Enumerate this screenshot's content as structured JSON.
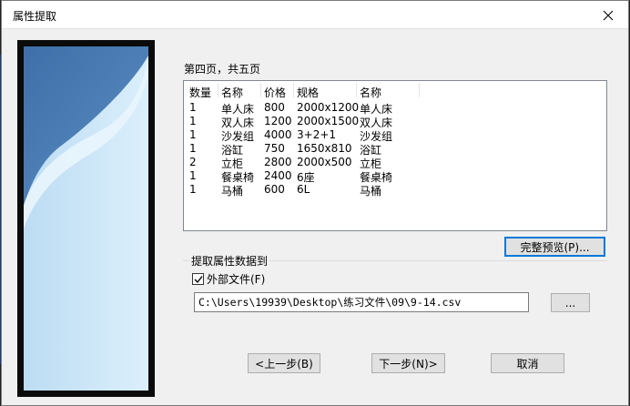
{
  "dialog": {
    "title": "属性提取",
    "close_icon": "close-icon"
  },
  "page_label": "第四页，共五页",
  "list": {
    "headers": [
      "数量",
      "名称",
      "价格",
      "规格",
      "名称"
    ],
    "rows": [
      [
        "1",
        "单人床",
        "800",
        "2000x1200",
        "单人床"
      ],
      [
        "1",
        "双人床",
        "1200",
        "2000x1500",
        "双人床"
      ],
      [
        "1",
        "沙发组",
        "4000",
        "3+2+1",
        "沙发组"
      ],
      [
        "1",
        "浴缸",
        "750",
        "1650x810",
        "浴缸"
      ],
      [
        "2",
        "立柜",
        "2800",
        "2000x500",
        "立柜"
      ],
      [
        "1",
        "餐桌椅",
        "2400",
        "6座",
        "餐桌椅"
      ],
      [
        "1",
        "马桶",
        "600",
        "6L",
        "马桶"
      ]
    ]
  },
  "buttons": {
    "preview": "完整预览(P)...",
    "browse": "...",
    "back": "<上一步(B)",
    "next": "下一步(N)>",
    "cancel": "取消"
  },
  "extract_group": {
    "title": "提取属性数据到",
    "checkbox_label": "外部文件(F)",
    "checkbox_checked": true,
    "path_value": "C:\\Users\\19939\\Desktop\\练习文件\\09\\9-14.csv"
  },
  "colors": {
    "accent": "#0078d7",
    "art_blue": "#4a7fb5"
  }
}
